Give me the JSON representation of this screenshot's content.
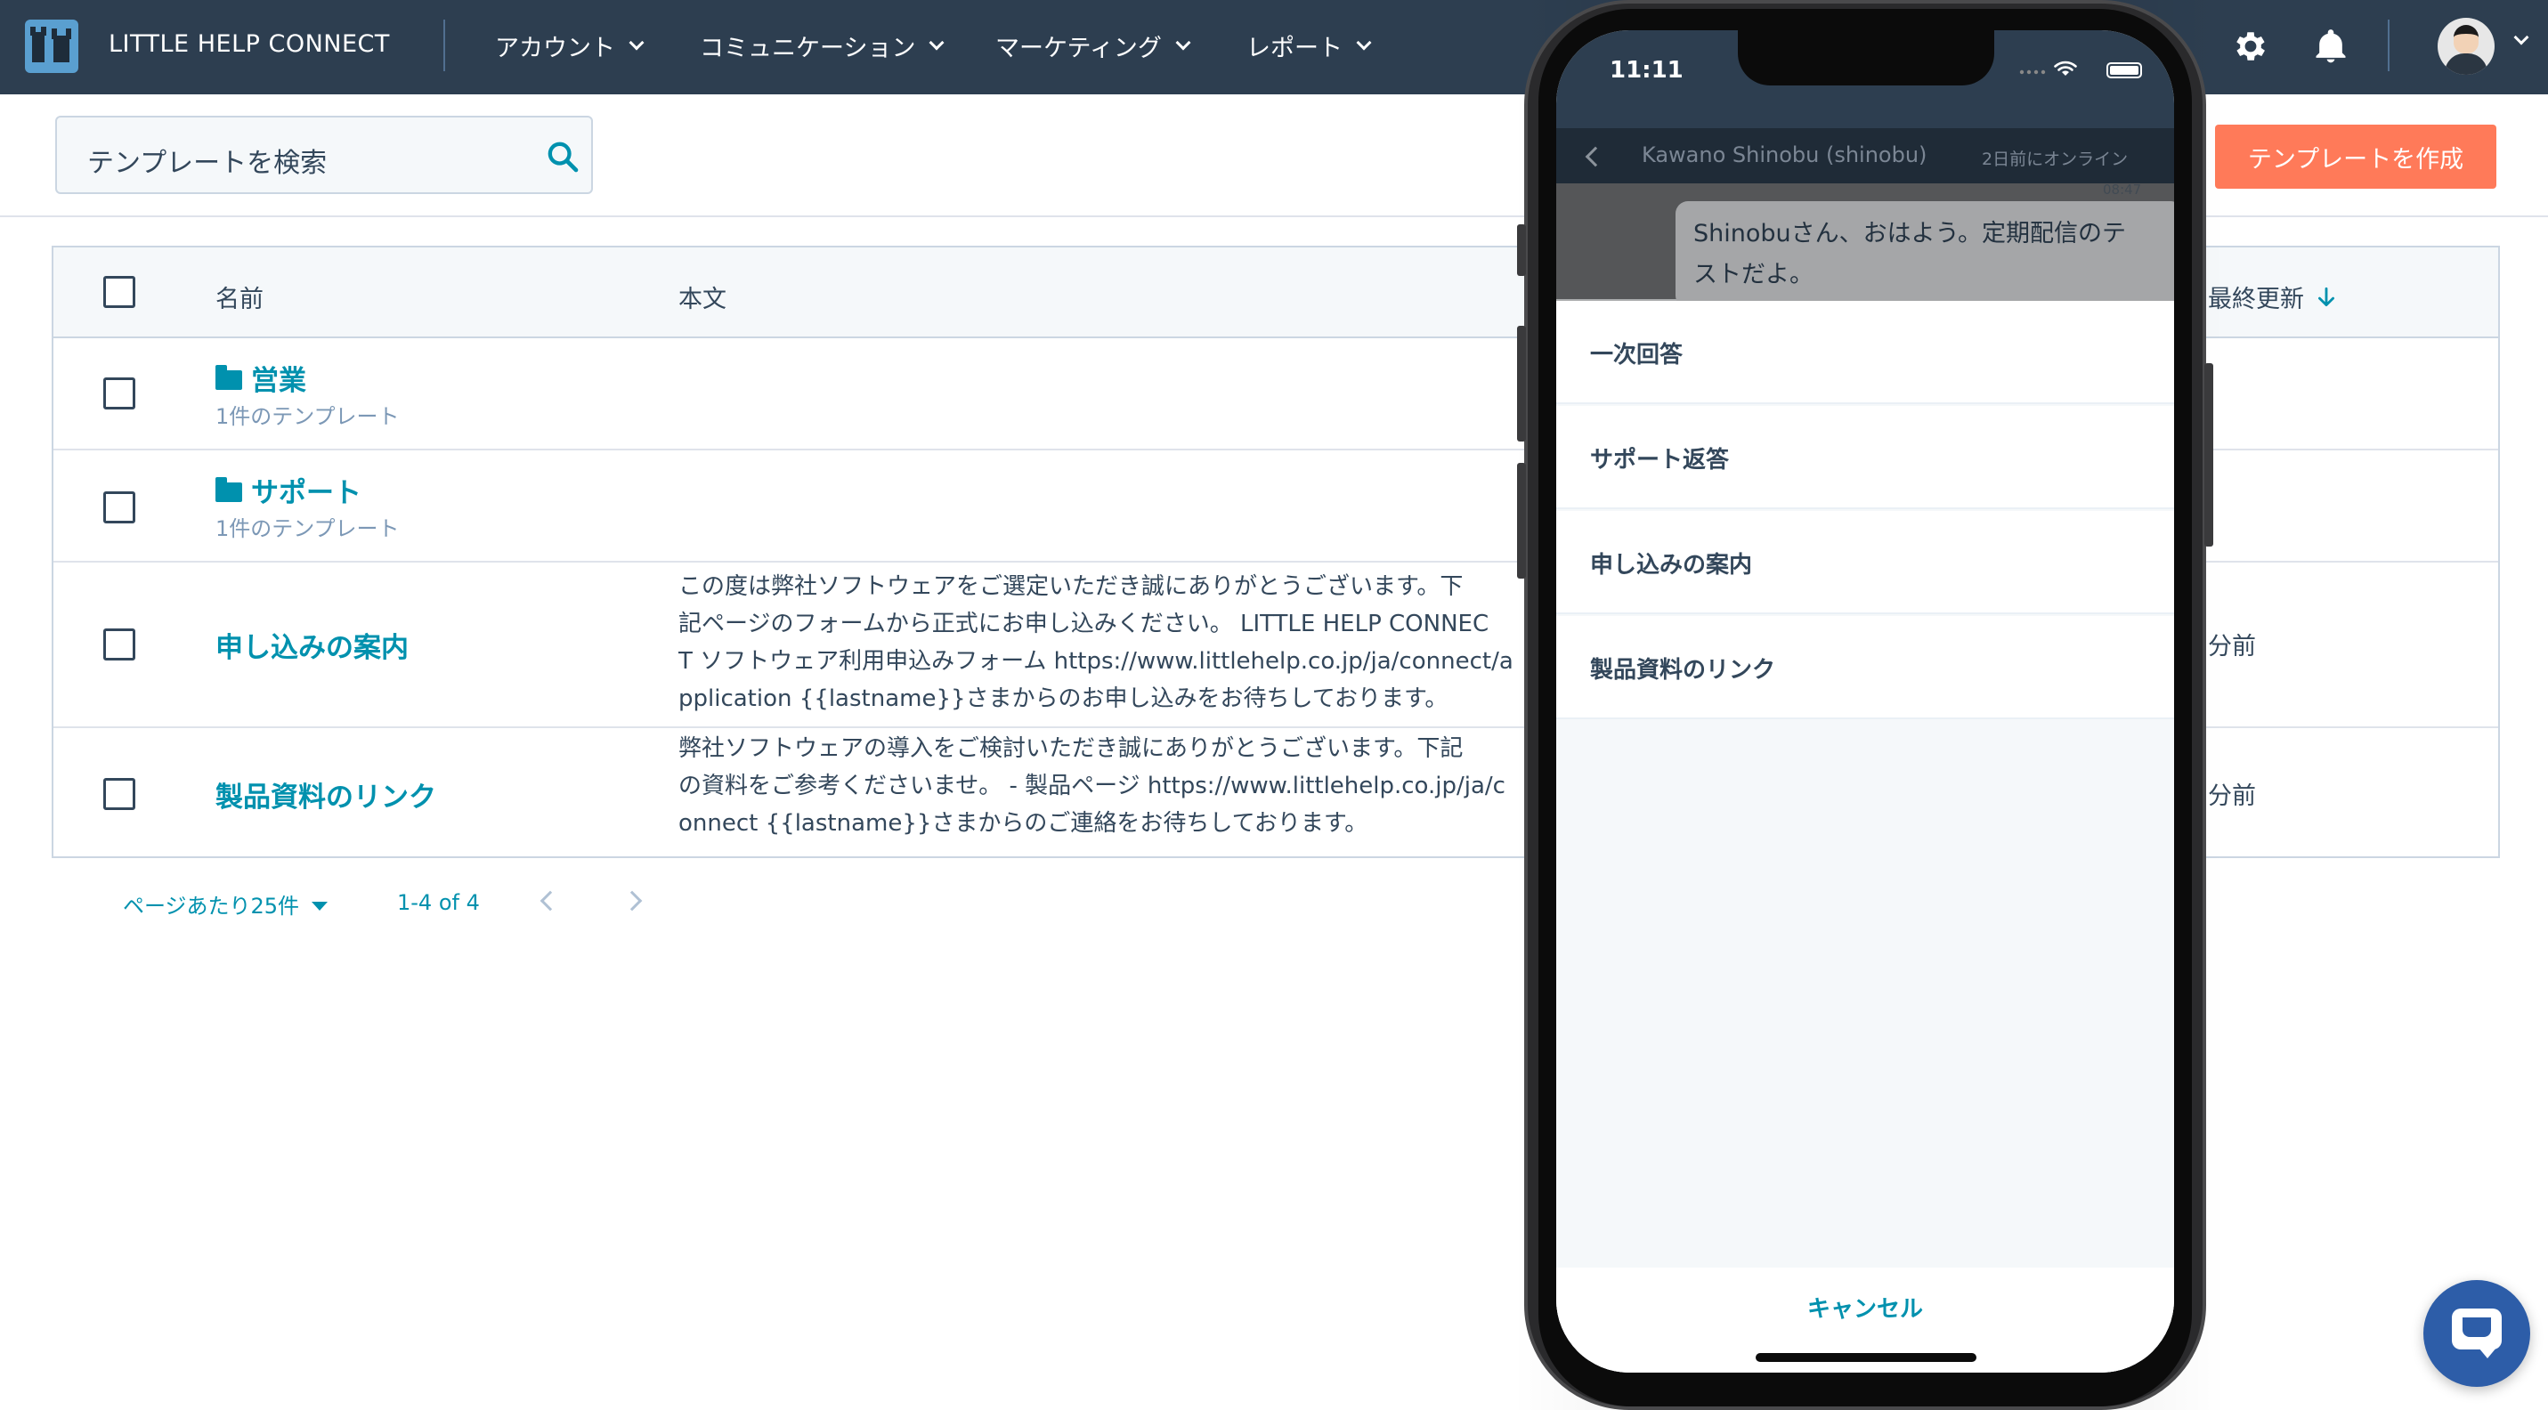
{
  "app": {
    "name": "LITTLE HELP CONNECT",
    "nav": [
      {
        "label": "アカウント"
      },
      {
        "label": "コミュニケーション"
      },
      {
        "label": "マーケティング"
      },
      {
        "label": "レポート"
      }
    ],
    "icons": {
      "settings": "gear-icon",
      "notifications": "bell-icon",
      "search": "search-icon"
    }
  },
  "toolbar": {
    "search_placeholder": "テンプレートを検索",
    "create_label": "テンプレートを作成"
  },
  "table": {
    "headers": {
      "name": "名前",
      "body": "本文",
      "updated": "最終更新"
    },
    "folders": [
      {
        "name": "営業",
        "count": "1件のテンプレート"
      },
      {
        "name": "サポート",
        "count": "1件のテンプレート"
      }
    ],
    "templates": [
      {
        "name": "申し込みの案内",
        "body": "この度は弊社ソフトウェアをご選定いただき誠にありがとうございます。下\n記ページのフォームから正式にお申し込みください。 LITTLE HELP CONNEC\nT ソフトウェア利用申込みフォーム https://www.littlehelp.co.jp/ja/connect/a\npplication {{lastname}}さまからのお申し込みをお待ちしております。",
        "updated": "分前"
      },
      {
        "name": "製品資料のリンク",
        "body": "弊社ソフトウェアの導入をご検討いただき誠にありがとうございます。下記\nの資料をご参考くださいませ。 - 製品ページ https://www.littlehelp.co.jp/ja/c\nonnect {{lastname}}さまからのご連絡をお待ちしております。",
        "updated": "分前"
      }
    ]
  },
  "pagination": {
    "per_page": "ページあたり25件",
    "range": "1-4 of 4"
  },
  "phone": {
    "time": "11:11",
    "chat_title": "Kawano Shinobu (shinobu)",
    "chat_status": "2日前にオンライン",
    "message_time": "08:47",
    "message": "Shinobuさん、おはよう。定期配信のテ\nストだよ。",
    "sheet_items": [
      {
        "label": "一次回答"
      },
      {
        "label": "サポート返答"
      },
      {
        "label": "申し込みの案内"
      },
      {
        "label": "製品資料のリンク"
      }
    ],
    "cancel_label": "キャンセル"
  },
  "colors": {
    "nav_bg": "#2d3e50",
    "accent": "#0091ae",
    "primary_button": "#ff7a59",
    "launcher": "#2d5da8"
  }
}
